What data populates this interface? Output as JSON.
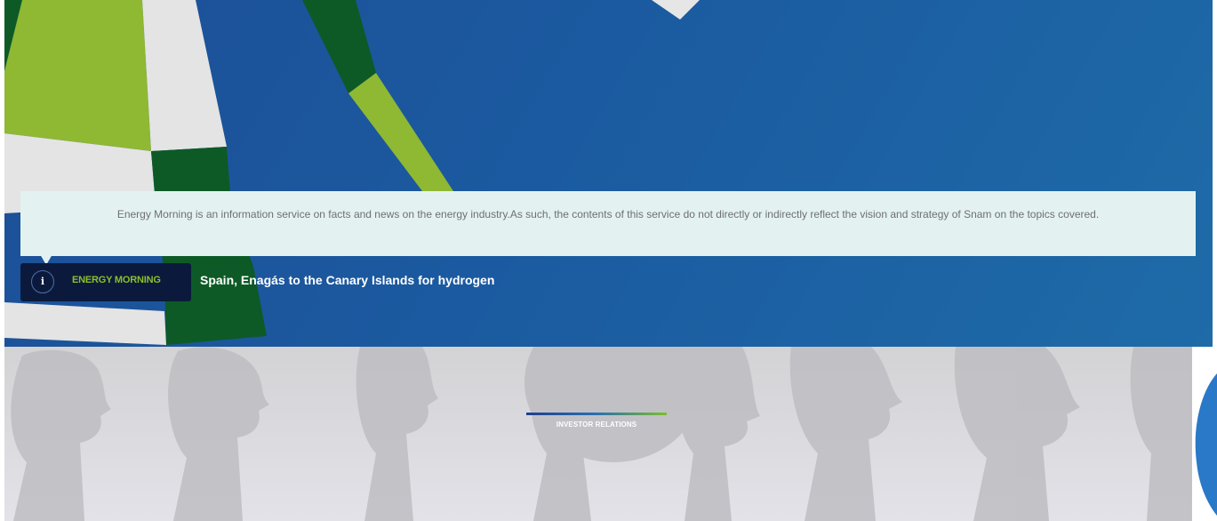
{
  "breadcrumb": "",
  "notice": {
    "text": "Energy Morning is an information service on facts and news on the energy industry.As such, the contents of this service do not directly or indirectly reflect the vision and strategy of Snam on the topics covered."
  },
  "energy_morning": {
    "icon": "info-icon",
    "icon_glyph": "i",
    "label": "ENERGY MORNING",
    "headline": "Spain, Enagás to the Canary Islands for hydrogen"
  },
  "investor_relations": {
    "label": "INVESTOR RELATIONS"
  },
  "colors": {
    "hero_blue": "#1b5aa0",
    "brand_green": "#8cbf2a",
    "dark_green": "#0d5a26",
    "badge_navy": "#0b1a3c",
    "notice_bg": "#e3f2f1"
  }
}
